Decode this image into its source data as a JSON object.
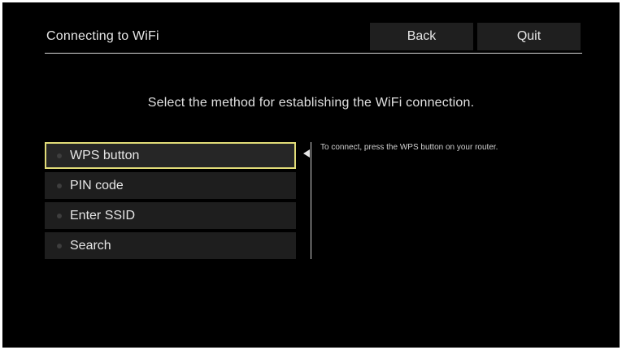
{
  "header": {
    "title": "Connecting to WiFi",
    "back_label": "Back",
    "quit_label": "Quit"
  },
  "instruction": "Select the method for establishing the WiFi connection.",
  "menu": {
    "selected_index": 0,
    "items": [
      {
        "label": "WPS button"
      },
      {
        "label": "PIN code"
      },
      {
        "label": "Enter SSID"
      },
      {
        "label": "Search"
      }
    ]
  },
  "help_text": "To connect, press the WPS button on your router.",
  "colors": {
    "background": "#000000",
    "selection_border": "#e1dc78",
    "item_background": "#1e1e1e",
    "button_background": "#1f1f1f"
  }
}
